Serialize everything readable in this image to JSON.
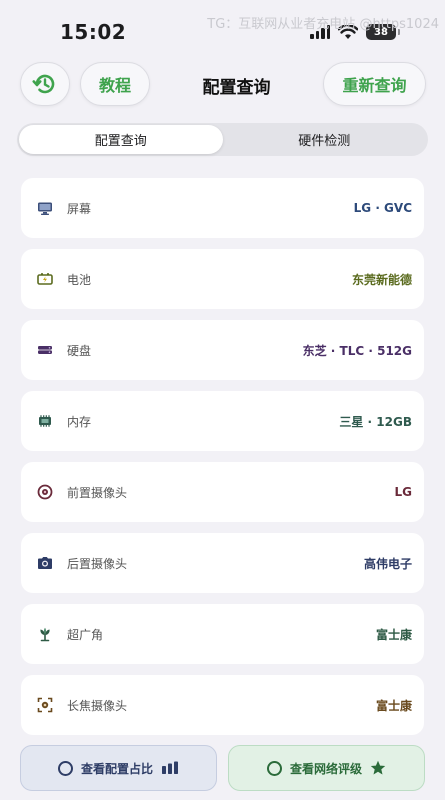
{
  "status_bar": {
    "time": "15:02",
    "battery": "38",
    "watermark": "TG：互联网从业者充电站 @https1024"
  },
  "header": {
    "history_icon": "history-clock-icon",
    "tutorial_label": "教程",
    "title": "配置查询",
    "requery_label": "重新查询"
  },
  "tabs": [
    {
      "label": "配置查询",
      "active": true
    },
    {
      "label": "硬件检测",
      "active": false
    }
  ],
  "rows": [
    {
      "icon": "monitor-icon",
      "label": "屏幕",
      "value": "LG · GVC",
      "color": "#2d4a7a"
    },
    {
      "icon": "battery-icon",
      "label": "电池",
      "value": "东莞新能德",
      "color": "#5b6b1f"
    },
    {
      "icon": "disk-icon",
      "label": "硬盘",
      "value": "东芝 · TLC · 512G",
      "color": "#4a2f66"
    },
    {
      "icon": "memory-chip-icon",
      "label": "内存",
      "value": "三星 · 12GB",
      "color": "#2f5a4e"
    },
    {
      "icon": "front-camera-icon",
      "label": "前置摄像头",
      "value": "LG",
      "color": "#6a2a3a"
    },
    {
      "icon": "camera-icon",
      "label": "后置摄像头",
      "value": "高伟电子",
      "color": "#2e3c66"
    },
    {
      "icon": "ultrawide-flower-icon",
      "label": "超广角",
      "value": "富士康",
      "color": "#2e5a45"
    },
    {
      "icon": "telephoto-icon",
      "label": "长焦摄像头",
      "value": "富士康",
      "color": "#6a4a1e"
    }
  ],
  "bottom": {
    "ratio_label": "查看配置占比",
    "rating_label": "查看网络评级"
  },
  "colors": {
    "accent_green": "#3fa34d",
    "background": "#f2f1f6"
  }
}
